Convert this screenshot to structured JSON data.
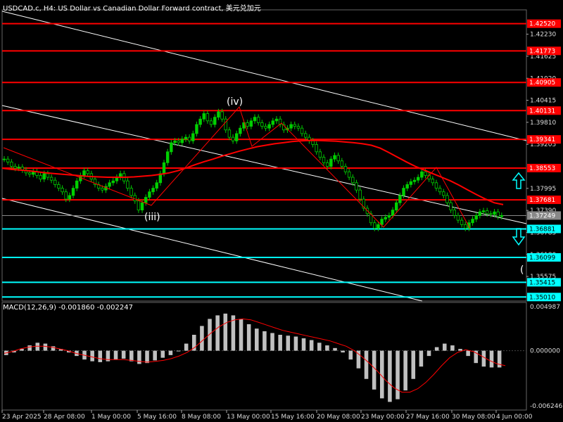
{
  "title": "USDCAD.c, H4:  US Dollar vs Canadian Dollar Forward contract, 美元兑加元",
  "colors": {
    "background": "#000000",
    "grid": "#3a4a5a",
    "bull": "#00d000",
    "bear": "#00d000",
    "resistance": "#ff0000",
    "support": "#00ffff",
    "ma": "#ff0000",
    "channel": "#ffffff",
    "macd_hist": "#c0c0c0",
    "macd_signal": "#ff0000",
    "up_arrow": "#00ffff",
    "down_arrow": "#00ffff"
  },
  "annotations": {
    "wave_iv": "(iv)",
    "wave_iii": "(iii)",
    "wave_partial": "("
  },
  "macd": {
    "label": "MACD(12,26,9) -0.001860 -0.002247",
    "axis_top": "0.004987",
    "axis_zero": "0.000000",
    "axis_bottom": "-0.006246"
  },
  "chart_data": {
    "type": "candlestick",
    "symbol": "USDCAD.c",
    "timeframe": "H4",
    "ylim": [
      1.349,
      1.429
    ],
    "y_ticks": [
      "1.42230",
      "1.41625",
      "1.41020",
      "1.40415",
      "1.39810",
      "1.39205",
      "1.37995",
      "1.37390",
      "1.36785",
      "1.36180",
      "1.35575"
    ],
    "x_ticks": [
      "23 Apr 2025",
      "28 Apr 08:00",
      "1 May 00:00",
      "5 May 16:00",
      "8 May 08:00",
      "13 May 00:00",
      "15 May 16:00",
      "20 May 08:00",
      "23 May 00:00",
      "27 May 16:00",
      "30 May 08:00",
      "4 Jun 00:00"
    ],
    "current_price": "1.37249",
    "resistance_levels": [
      {
        "label": "1.42520",
        "value": 1.4252
      },
      {
        "label": "1.41773",
        "value": 1.41773
      },
      {
        "label": "1.40905",
        "value": 1.40905
      },
      {
        "label": "1.40131",
        "value": 1.40131
      },
      {
        "label": "1.39341",
        "value": 1.39341
      },
      {
        "label": "1.38553",
        "value": 1.38553
      },
      {
        "label": "1.37681",
        "value": 1.37681
      }
    ],
    "support_levels": [
      {
        "label": "1.36881",
        "value": 1.36881
      },
      {
        "label": "1.36099",
        "value": 1.36099
      },
      {
        "label": "1.35415",
        "value": 1.35415
      },
      {
        "label": "1.35010",
        "value": 1.3501
      }
    ],
    "close_path": [
      1.388,
      1.3872,
      1.386,
      1.3855,
      1.3858,
      1.385,
      1.3842,
      1.3838,
      1.3845,
      1.3835,
      1.3825,
      1.384,
      1.383,
      1.3822,
      1.381,
      1.38,
      1.379,
      1.377,
      1.378,
      1.38,
      1.382,
      1.3835,
      1.3848,
      1.384,
      1.3825,
      1.381,
      1.38,
      1.3795,
      1.3805,
      1.3815,
      1.382,
      1.383,
      1.384,
      1.382,
      1.38,
      1.378,
      1.3765,
      1.374,
      1.376,
      1.3775,
      1.379,
      1.38,
      1.3815,
      1.384,
      1.387,
      1.39,
      1.3925,
      1.393,
      1.3925,
      1.3935,
      1.394,
      1.393,
      1.395,
      1.3975,
      1.399,
      1.4005,
      1.3985,
      1.3975,
      1.3995,
      1.401,
      1.399,
      1.396,
      1.394,
      1.393,
      1.395,
      1.3965,
      1.398,
      1.397,
      1.3985,
      1.3995,
      1.398,
      1.397,
      1.3965,
      1.3975,
      1.3985,
      1.399,
      1.3975,
      1.396,
      1.3965,
      1.3975,
      1.397,
      1.3965,
      1.395,
      1.394,
      1.393,
      1.392,
      1.39,
      1.3885,
      1.387,
      1.386,
      1.388,
      1.389,
      1.3875,
      1.386,
      1.3845,
      1.383,
      1.3815,
      1.3795,
      1.377,
      1.3745,
      1.373,
      1.3705,
      1.369,
      1.37,
      1.3715,
      1.372,
      1.3725,
      1.374,
      1.376,
      1.378,
      1.38,
      1.381,
      1.3818,
      1.3822,
      1.383,
      1.3845,
      1.3835,
      1.3825,
      1.3815,
      1.38,
      1.379,
      1.378,
      1.376,
      1.374,
      1.3725,
      1.3712,
      1.37,
      1.369,
      1.3705,
      1.3715,
      1.3725,
      1.3735,
      1.3738,
      1.373,
      1.3728,
      1.3735,
      1.3722,
      1.3725
    ],
    "ma_path": [
      1.3855,
      1.3852,
      1.385,
      1.3848,
      1.3845,
      1.3842,
      1.384,
      1.3838,
      1.3836,
      1.3834,
      1.3832,
      1.3831,
      1.383,
      1.383,
      1.383,
      1.3831,
      1.3833,
      1.3835,
      1.3838,
      1.3842,
      1.3848,
      1.3856,
      1.3865,
      1.3873,
      1.388,
      1.3888,
      1.3895,
      1.3902,
      1.3908,
      1.3914,
      1.3918,
      1.3922,
      1.3925,
      1.3928,
      1.393,
      1.3931,
      1.3931,
      1.393,
      1.3929,
      1.3927,
      1.3925,
      1.3922,
      1.3918,
      1.391,
      1.3898,
      1.3885,
      1.3872,
      1.386,
      1.385,
      1.384,
      1.383,
      1.382,
      1.3808,
      1.3795,
      1.3782,
      1.377,
      1.376,
      1.3755
    ],
    "macd_hist": [
      -0.0005,
      -0.0002,
      0.0002,
      0.0006,
      0.0009,
      0.0008,
      0.0005,
      0.0002,
      -0.0002,
      -0.0006,
      -0.001,
      -0.0012,
      -0.0013,
      -0.0012,
      -0.001,
      -0.0009,
      -0.0012,
      -0.0015,
      -0.0014,
      -0.0011,
      -0.0008,
      -0.0005,
      0.0,
      0.0008,
      0.0018,
      0.0028,
      0.0036,
      0.004,
      0.0042,
      0.004,
      0.0036,
      0.003,
      0.0025,
      0.0022,
      0.002,
      0.0018,
      0.0017,
      0.0016,
      0.0014,
      0.0012,
      0.0009,
      0.0006,
      0.0003,
      -0.0002,
      -0.001,
      -0.002,
      -0.0032,
      -0.0044,
      -0.0054,
      -0.0058,
      -0.0055,
      -0.0045,
      -0.0032,
      -0.0018,
      -0.0006,
      0.0004,
      0.0008,
      0.0006,
      0.0002,
      -0.0006,
      -0.0014,
      -0.0018,
      -0.0019,
      -0.0019
    ],
    "macd_signal": [
      -0.0003,
      -0.0001,
      0.0002,
      0.0004,
      0.0005,
      0.0005,
      0.0004,
      0.0002,
      0.0,
      -0.0003,
      -0.0005,
      -0.0007,
      -0.0009,
      -0.001,
      -0.001,
      -0.001,
      -0.0011,
      -0.0012,
      -0.0013,
      -0.0012,
      -0.0011,
      -0.0009,
      -0.0006,
      -0.0002,
      0.0004,
      0.0012,
      0.002,
      0.0027,
      0.0032,
      0.0035,
      0.0036,
      0.0035,
      0.0032,
      0.0029,
      0.0026,
      0.0023,
      0.0021,
      0.0019,
      0.0017,
      0.0015,
      0.0013,
      0.0011,
      0.0008,
      0.0005,
      0.0,
      -0.0007,
      -0.0015,
      -0.0024,
      -0.0034,
      -0.0042,
      -0.0047,
      -0.0047,
      -0.0043,
      -0.0036,
      -0.0027,
      -0.0017,
      -0.0008,
      -0.0002,
      0.0001,
      -0.0001,
      -0.0006,
      -0.0011,
      -0.0015,
      -0.0017
    ]
  }
}
